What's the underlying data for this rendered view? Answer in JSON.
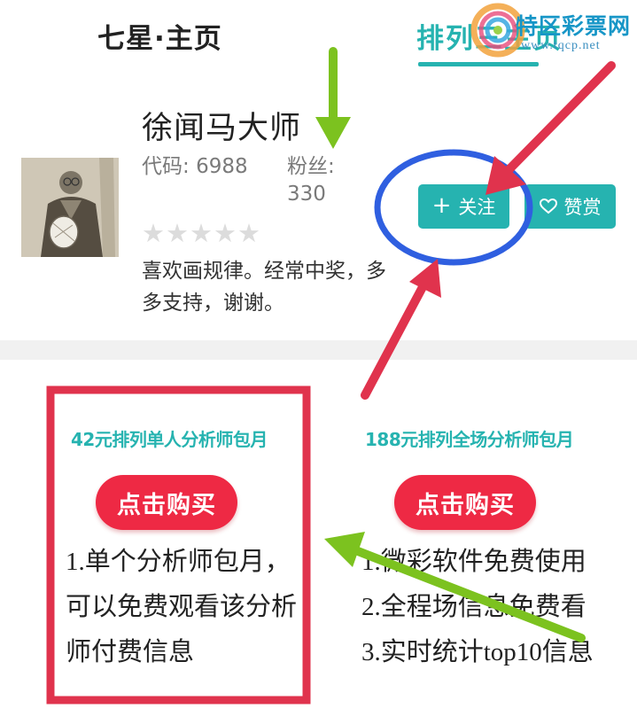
{
  "tabs": {
    "home": "七星·主页",
    "rank": "排列三主页"
  },
  "watermark": {
    "title": "特区彩票网",
    "url": "www.tqcp.net"
  },
  "profile": {
    "name": "徐闻马大师",
    "code_label": "代码:",
    "code_value": "6988",
    "fans_label": "粉丝:",
    "fans_value": "330",
    "rating": 0,
    "rating_max": 5,
    "stars": "★★★★★",
    "bio": "喜欢画规律。经常中奖，多多支持，谢谢。",
    "follow_label": "关注",
    "follow_icon": "plus-icon",
    "reward_label": "赞赏",
    "reward_icon": "heart-icon"
  },
  "plans": [
    {
      "title": "42元排列单人分析师包月",
      "buy_label": "点击购买",
      "features": [
        "1.单个分析师包月，",
        "可以免费观看该分析",
        "师付费信息"
      ]
    },
    {
      "title": "188元排列全场分析师包月",
      "buy_label": "点击购买",
      "features": [
        "1.微彩软件免费使用",
        "2.全程场信息免费看",
        "3.实时统计top10信息"
      ]
    }
  ],
  "colors": {
    "accent": "#26b3b0",
    "buy": "#ee2944",
    "annotation_red": "#e0334d",
    "annotation_green": "#7cc21f",
    "annotation_blue": "#2f5fe0"
  }
}
